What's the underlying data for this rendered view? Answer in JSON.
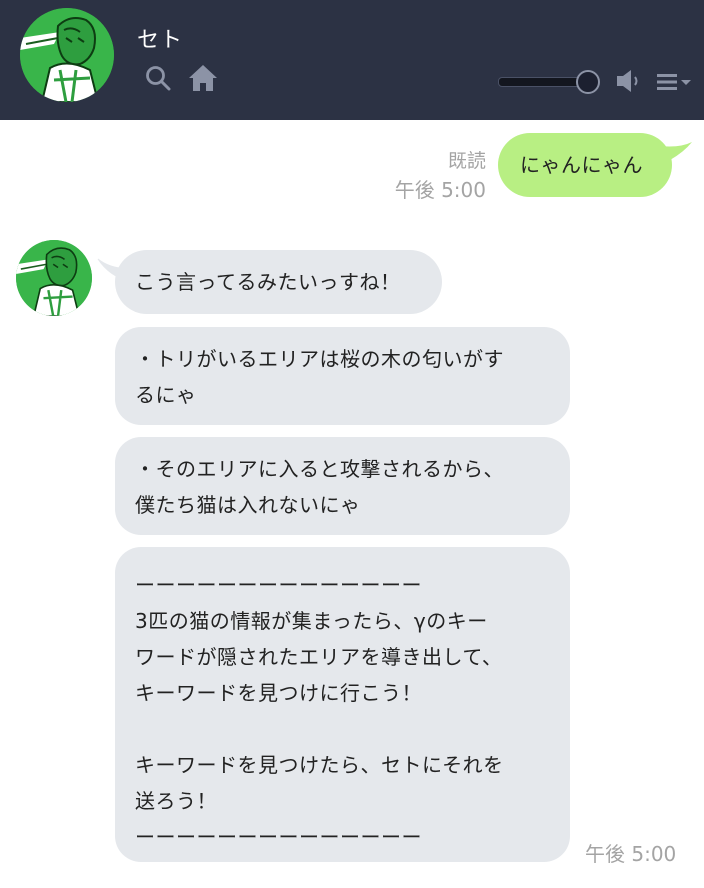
{
  "header": {
    "contact_name": "セト",
    "icons": [
      "avatar",
      "search-icon",
      "home-icon",
      "volume-slider",
      "speaker-icon",
      "menu-icon"
    ],
    "volume_level": 0.85,
    "colors": {
      "background": "#2c3244",
      "title": "#ffffff",
      "icon": "#8c93a6"
    }
  },
  "messages": [
    {
      "direction": "outgoing",
      "text": "にゃんにゃん",
      "status": "既読",
      "time": "午後 5:00",
      "bubble_color": "#b8ef83"
    },
    {
      "direction": "incoming",
      "bubbles": [
        "こう言ってるみたいっすね！",
        "・トリがいるエリアは桜の木の匂いがす\nるにゃ",
        "・そのエリアに入ると攻撃されるから、\n僕たち猫は入れないにゃ",
        "ーーーーーーーーーーーーーー\n3匹の猫の情報が集まったら、γのキー\nワードが隠されたエリアを導き出して、\nキーワードを見つけに行こう！\n\nキーワードを見つけたら、セトにそれを\n送ろう！\nーーーーーーーーーーーーーー"
      ],
      "time": "午後 5:00",
      "bubble_color": "#e5e8ec"
    }
  ]
}
